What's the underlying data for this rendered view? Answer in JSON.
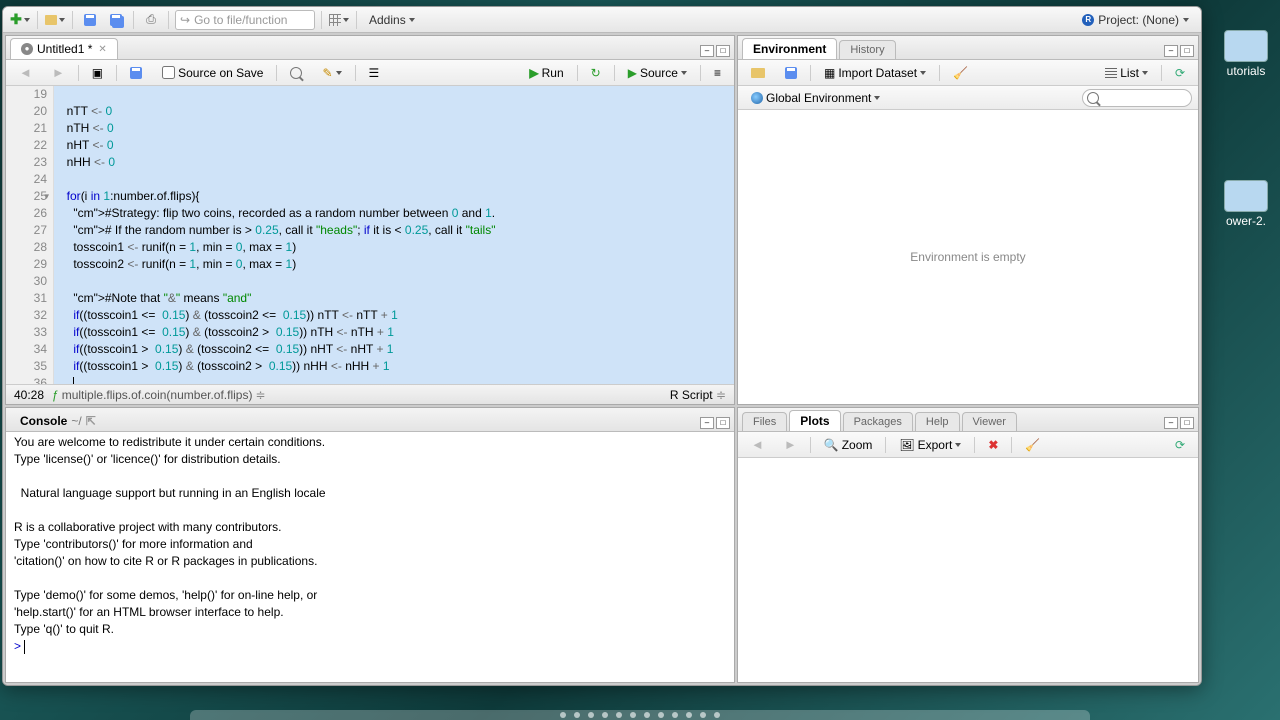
{
  "project_label": "Project: (None)",
  "goto_placeholder": "Go to file/function",
  "addins_label": "Addins",
  "desktop": {
    "item1": "utorials",
    "item2": "ower-2."
  },
  "source": {
    "tab_title": "Untitled1 *",
    "source_on_save": "Source on Save",
    "run": "Run",
    "source_btn": "Source",
    "cursor_pos": "40:28",
    "func_context": "multiple.flips.of.coin(number.of.flips)",
    "lang": "R Script",
    "lines": [
      {
        "n": 19,
        "t": ""
      },
      {
        "n": 20,
        "t": "  nTT <- 0"
      },
      {
        "n": 21,
        "t": "  nTH <- 0"
      },
      {
        "n": 22,
        "t": "  nHT <- 0"
      },
      {
        "n": 23,
        "t": "  nHH <- 0"
      },
      {
        "n": 24,
        "t": ""
      },
      {
        "n": 25,
        "t": "  for(i in 1:number.of.flips){",
        "fold": true
      },
      {
        "n": 26,
        "t": "    #Strategy: flip two coins, recorded as a random number between 0 and 1."
      },
      {
        "n": 27,
        "t": "    # If the random number is > 0.25, call it \"heads\"; if it is < 0.25, call it \"tails\""
      },
      {
        "n": 28,
        "t": "    tosscoin1 <- runif(n = 1, min = 0, max = 1)"
      },
      {
        "n": 29,
        "t": "    tosscoin2 <- runif(n = 1, min = 0, max = 1)"
      },
      {
        "n": 30,
        "t": ""
      },
      {
        "n": 31,
        "t": "    #Note that \"&\" means \"and\""
      },
      {
        "n": 32,
        "t": "    if((tosscoin1 <=  0.15) & (tosscoin2 <=  0.15)) nTT <- nTT + 1"
      },
      {
        "n": 33,
        "t": "    if((tosscoin1 <=  0.15) & (tosscoin2 >  0.15)) nTH <- nTH + 1"
      },
      {
        "n": 34,
        "t": "    if((tosscoin1 >  0.15) & (tosscoin2 <=  0.15)) nHT <- nHT + 1"
      },
      {
        "n": 35,
        "t": "    if((tosscoin1 >  0.15) & (tosscoin2 >  0.15)) nHH <- nHH + 1"
      },
      {
        "n": 36,
        "t": "    "
      }
    ]
  },
  "console": {
    "title": "Console",
    "wd": "~/",
    "text": "You are welcome to redistribute it under certain conditions.\nType 'license()' or 'licence()' for distribution details.\n\n  Natural language support but running in an English locale\n\nR is a collaborative project with many contributors.\nType 'contributors()' for more information and\n'citation()' on how to cite R or R packages in publications.\n\nType 'demo()' for some demos, 'help()' for on-line help, or\n'help.start()' for an HTML browser interface to help.\nType 'q()' to quit R.\n",
    "prompt": "> "
  },
  "env": {
    "tabs": [
      "Environment",
      "History"
    ],
    "import": "Import Dataset",
    "scope": "Global Environment",
    "list": "List",
    "empty": "Environment is empty"
  },
  "plots": {
    "tabs": [
      "Files",
      "Plots",
      "Packages",
      "Help",
      "Viewer"
    ],
    "zoom": "Zoom",
    "export": "Export"
  }
}
